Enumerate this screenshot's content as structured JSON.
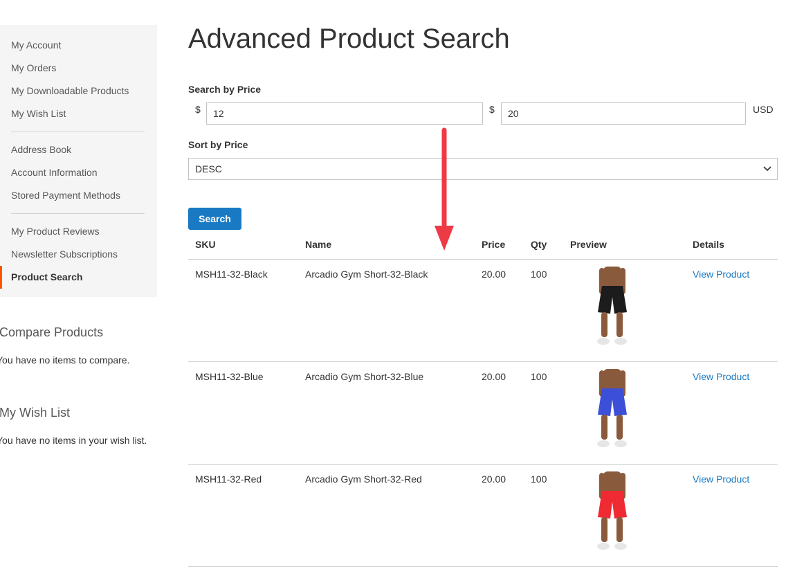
{
  "sidebar": {
    "groups": [
      [
        {
          "label": "My Account"
        },
        {
          "label": "My Orders"
        },
        {
          "label": "My Downloadable Products"
        },
        {
          "label": "My Wish List"
        }
      ],
      [
        {
          "label": "Address Book"
        },
        {
          "label": "Account Information"
        },
        {
          "label": "Stored Payment Methods"
        }
      ],
      [
        {
          "label": "My Product Reviews"
        },
        {
          "label": "Newsletter Subscriptions"
        },
        {
          "label": "Product Search",
          "current": true
        }
      ]
    ]
  },
  "compare": {
    "title": "Compare Products",
    "text": "You have no items to compare."
  },
  "wishlist_block": {
    "title": "My Wish List",
    "text": "You have no items in your wish list."
  },
  "page": {
    "title": "Advanced Product Search"
  },
  "search": {
    "price_label": "Search by Price",
    "currency_symbol": "$",
    "min_value": "12",
    "max_value": "20",
    "currency_code": "USD",
    "sort_label": "Sort by Price",
    "sort_value": "DESC",
    "button_label": "Search"
  },
  "table": {
    "headers": {
      "sku": "SKU",
      "name": "Name",
      "price": "Price",
      "qty": "Qty",
      "preview": "Preview",
      "details": "Details"
    },
    "rows": [
      {
        "sku": "MSH11-32-Black",
        "name": "Arcadio Gym Short-32-Black",
        "price": "20.00",
        "qty": "100",
        "details": "View Product",
        "shorts_color": "#1c1c1c"
      },
      {
        "sku": "MSH11-32-Blue",
        "name": "Arcadio Gym Short-32-Blue",
        "price": "20.00",
        "qty": "100",
        "details": "View Product",
        "shorts_color": "#3b4fd8"
      },
      {
        "sku": "MSH11-32-Red",
        "name": "Arcadio Gym Short-32-Red",
        "price": "20.00",
        "qty": "100",
        "details": "View Product",
        "shorts_color": "#f02a33"
      }
    ]
  },
  "colors": {
    "accent": "#1979c3",
    "current_marker": "#ff5501",
    "arrow": "#ee3a45",
    "sidebar_bg": "#f5f5f5"
  }
}
